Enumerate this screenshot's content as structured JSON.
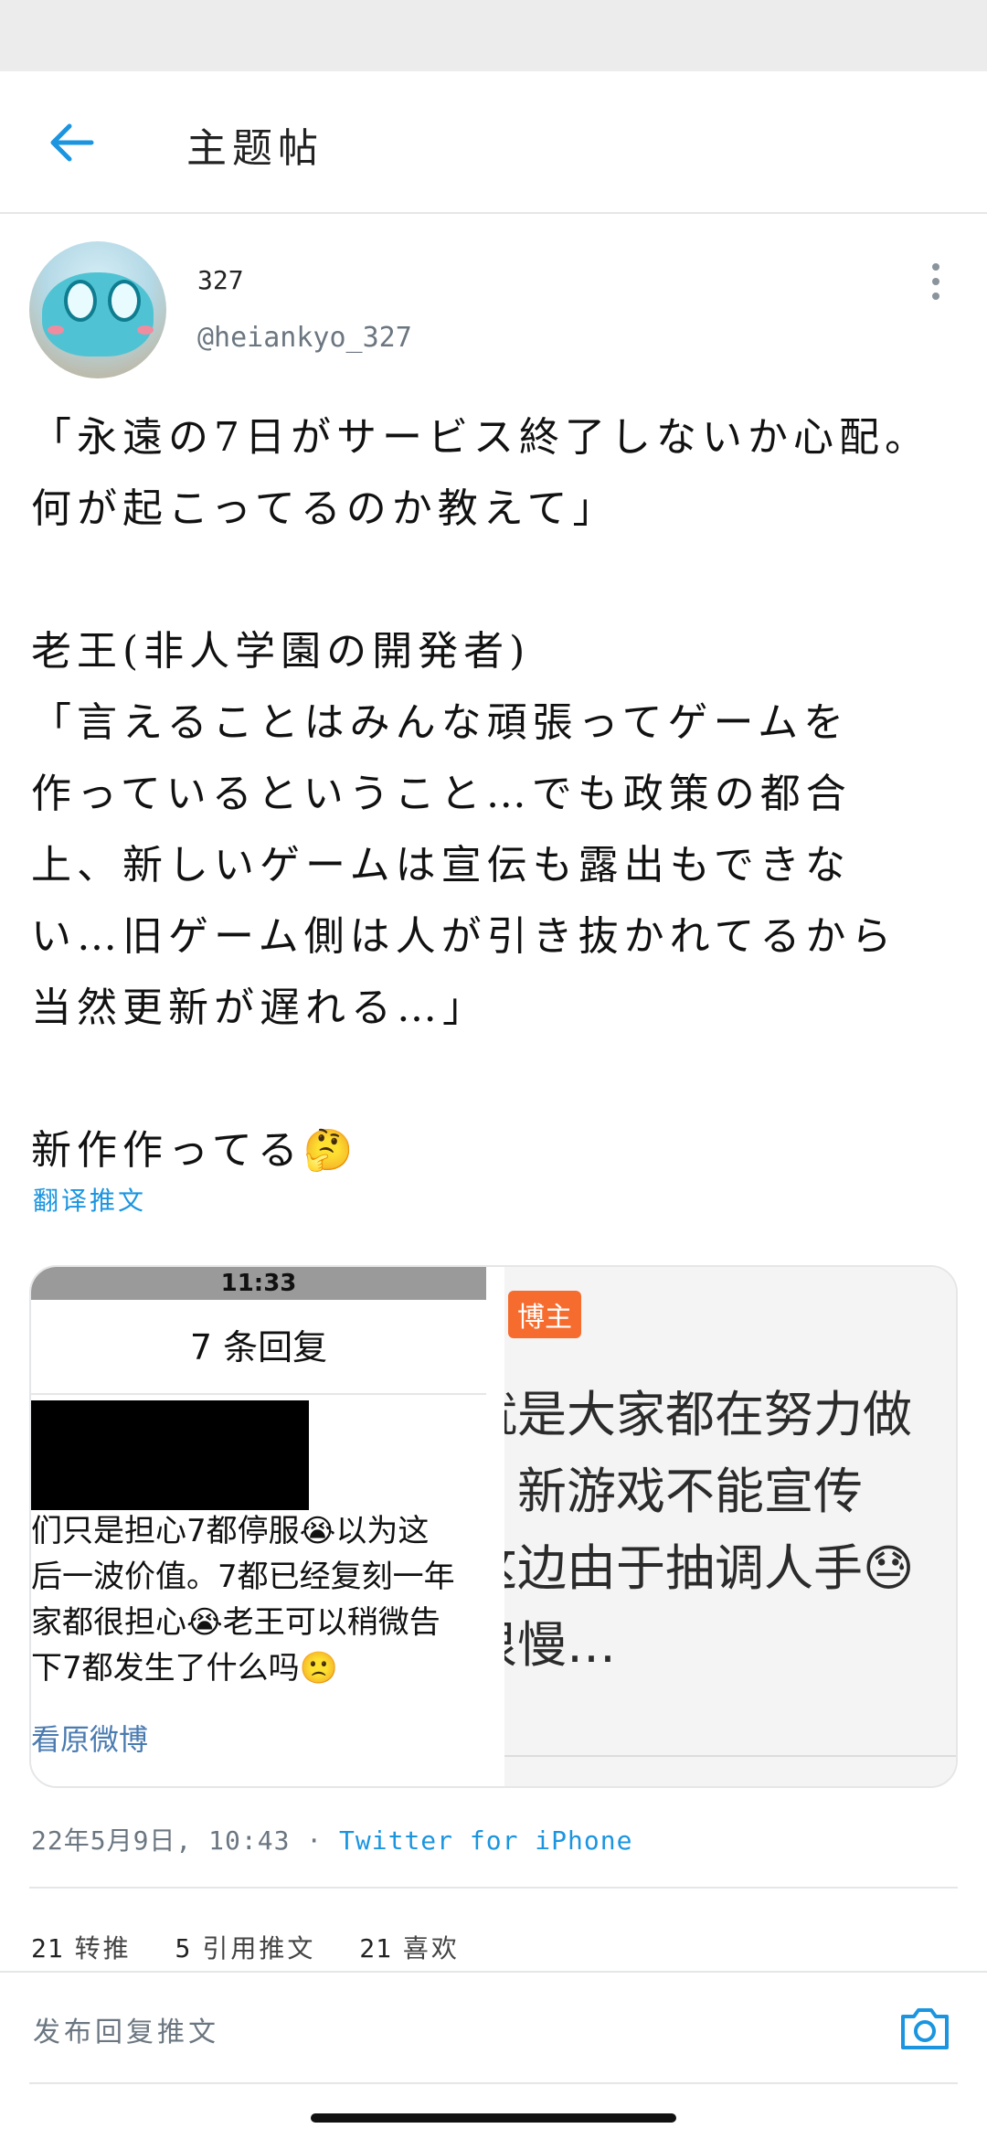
{
  "header": {
    "title": "主题帖"
  },
  "author": {
    "name": "327",
    "handle": "@heiankyo_327"
  },
  "tweet": {
    "text": "「永遠の7日がサービス終了しないか心配。\n何が起こってるのか教えて」\n\n老王(非人学園の開発者)\n「言えることはみんな頑張ってゲームを\n作っているということ…でも政策の都合\n上、新しいゲームは宣伝も露出もできな\nい…旧ゲーム側は人が引き抜かれてるから\n当然更新が遅れる…」\n\n新作作ってる🤔",
    "translate_label": "翻译推文"
  },
  "media": {
    "left": {
      "time": "11:33",
      "title": "7 条回复",
      "text": "们只是担心7都停服😭以为这\n后一波价值。7都已经复刻一年\n家都很担心😭老王可以稍微告\n下7都发生了什么吗🙁",
      "link": "看原微博"
    },
    "right": {
      "badge": "博主",
      "text": "就是大家都在努力做\n，新游戏不能宣传\n这边由于抽调人手😓\n很慢…"
    }
  },
  "meta": {
    "date": "22年5月9日, 10:43 · ",
    "via": "Twitter for iPhone"
  },
  "stats": {
    "retweets": "21",
    "retweets_label": "转推",
    "quotes": "5",
    "quotes_label": "引用推文",
    "likes": "21",
    "likes_label": "喜欢"
  },
  "reply": {
    "placeholder": "发布回复推文"
  },
  "colors": {
    "accent": "#1b95e0",
    "badge": "#f56c2e"
  },
  "icons": {
    "back": "arrow-left-icon",
    "more": "more-vertical-icon",
    "camera": "camera-icon"
  }
}
